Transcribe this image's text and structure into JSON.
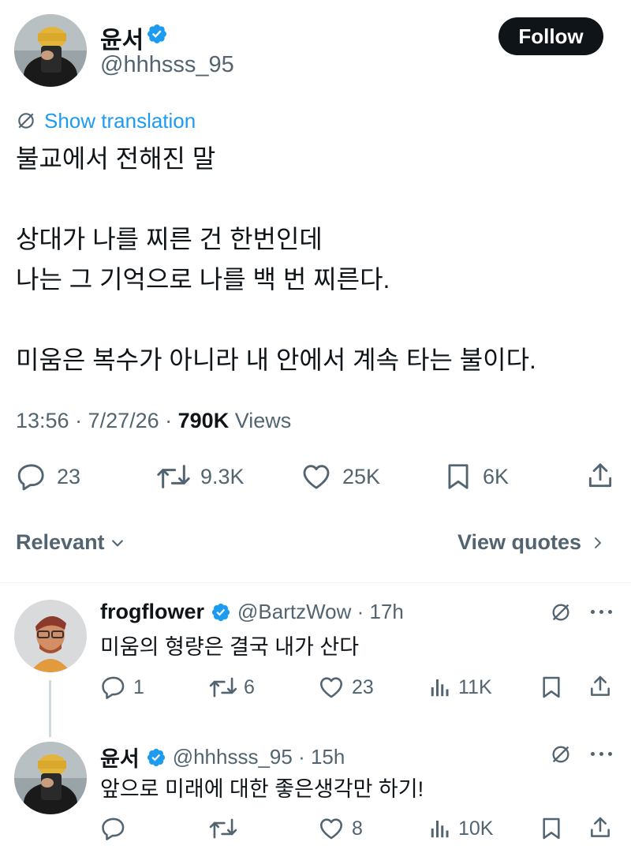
{
  "post": {
    "author_name": "윤서",
    "author_handle": "@hhhsss_95",
    "follow_label": "Follow",
    "show_translation": "Show translation",
    "body": "불교에서 전해진 말\n\n상대가 나를 찌른 건 한번인데\n나는 그 기억으로 나를 백 번 찌른다.\n\n미움은 복수가 아니라 내 안에서 계속 타는 불이다.",
    "time": "13:56 · 7/27/26 · ",
    "views_count": "790K",
    "views_label": " Views",
    "stats": {
      "replies": "23",
      "reposts": "9.3K",
      "likes": "25K",
      "bookmarks": "6K"
    }
  },
  "filter": {
    "sort_label": "Relevant",
    "view_quotes_label": "View quotes"
  },
  "replies": [
    {
      "name": "frogflower",
      "handle_time": "@BartzWow · 17h",
      "text": "미움의 형량은 결국 내가 산다",
      "stats": {
        "replies": "1",
        "reposts": "6",
        "likes": "23",
        "views": "11K"
      }
    },
    {
      "name": "윤서",
      "handle_time": "@hhhsss_95 · 15h",
      "text": "앞으로 미래에 대한 좋은생각만 하기!",
      "stats": {
        "replies": "",
        "reposts": "",
        "likes": "8",
        "views": "10K"
      }
    }
  ],
  "colors": {
    "verified": "#1d9bf0",
    "link": "#1d9bf0",
    "text_primary": "#0f1419",
    "text_secondary": "#536471"
  }
}
